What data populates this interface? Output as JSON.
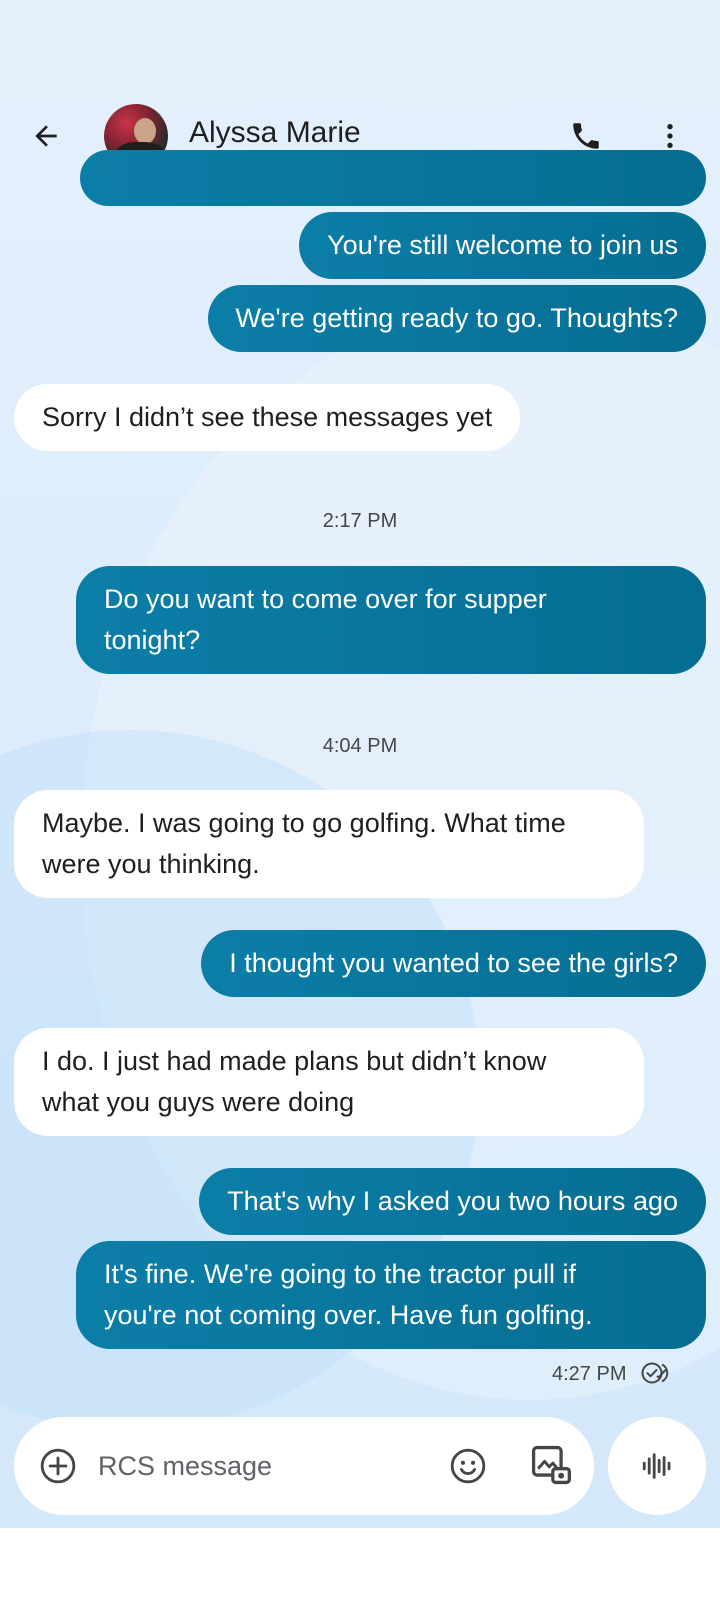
{
  "header": {
    "contact_name": "Alyssa Marie"
  },
  "messages": [
    {
      "dir": "out",
      "text": "You're still welcome to join us"
    },
    {
      "dir": "out",
      "text": "We're getting ready to go. Thoughts?"
    },
    {
      "dir": "in",
      "text": "Sorry I didn’t see these messages yet"
    },
    {
      "dir": "stamp",
      "text": "2:17 PM"
    },
    {
      "dir": "out",
      "text": "Do you want to come over for supper\ntonight?"
    },
    {
      "dir": "stamp",
      "text": "4:04 PM"
    },
    {
      "dir": "in",
      "text": "Maybe. I was going to go golfing. What time\nwere you thinking."
    },
    {
      "dir": "out",
      "text": "I thought you wanted to see the girls?"
    },
    {
      "dir": "in",
      "text": "I do. I just had made plans but didn’t know\nwhat you guys were doing"
    },
    {
      "dir": "out",
      "text": "That's why I asked you two hours ago"
    },
    {
      "dir": "out",
      "text": "It's fine. We're going to the tractor pull if\nyou're not coming over. Have fun golfing."
    }
  ],
  "footer": {
    "last_time": "4:27 PM",
    "receipt_icon": "read-receipt-icon"
  },
  "composer": {
    "placeholder": "RCS message",
    "value": ""
  },
  "icons": {
    "back": "arrow-left-icon",
    "call": "phone-icon",
    "more": "more-vert-icon",
    "add": "add-circle-icon",
    "emoji": "emoji-icon",
    "gallery": "gallery-icon",
    "voice": "voice-waveform-icon"
  },
  "colors": {
    "outgoing_bubble": "#0b7ea8",
    "incoming_bubble": "#ffffff",
    "background": "#dcecfb"
  }
}
